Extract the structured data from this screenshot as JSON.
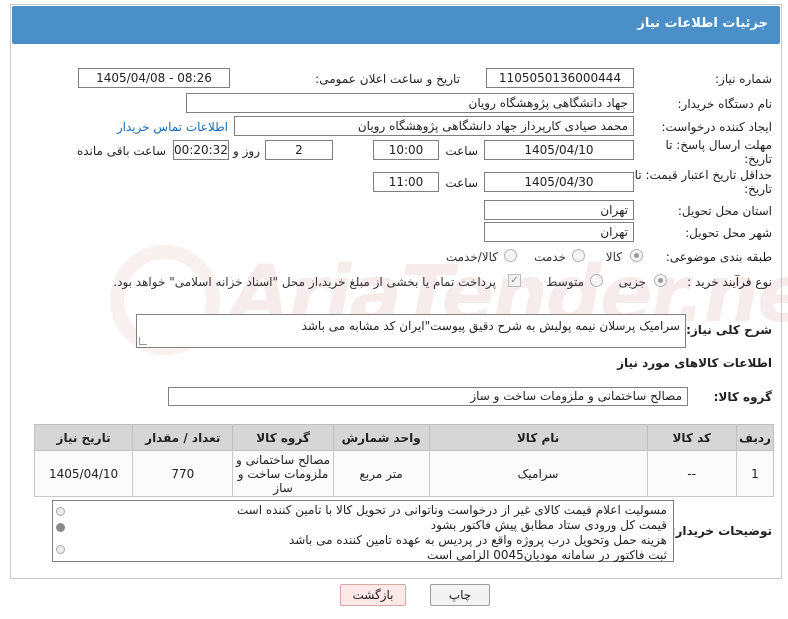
{
  "page": {
    "title": "جزئیات اطلاعات نیاز"
  },
  "form": {
    "need_number_label": "شماره نیاز:",
    "need_number": "1105050136000444",
    "announce_label": "تاریخ و ساعت اعلان عمومی:",
    "announce_value": "1405/04/08 - 08:26",
    "buyer_org_label": "نام دستگاه خریدار:",
    "buyer_org": "جهاد دانشگاهی پژوهشگاه رویان",
    "creator_label": "ایجاد کننده درخواست:",
    "creator": "محمد صیادی کارپرداز جهاد دانشگاهی پژوهشگاه رویان",
    "contact_link": "اطلاعات تماس خریدار",
    "deadline_label": "مهلت ارسال پاسخ: تا تاریخ:",
    "deadline_date": "1405/04/10",
    "time_label": "ساعت",
    "deadline_time": "10:00",
    "days_value": "2",
    "days_label": "روز و",
    "remaining_time": "00:20:32",
    "remaining_label": "ساعت باقی مانده",
    "validity_label": "حداقل تاریخ اعتبار قیمت: تا تاریخ:",
    "validity_date": "1405/04/30",
    "validity_time_label": "ساعت",
    "validity_time": "11:00",
    "province_label": "استان محل تحویل:",
    "province": "تهران",
    "city_label": "شهر محل تحویل:",
    "city": "تهران",
    "category_label": "طبقه بندی موضوعی:",
    "category_options": [
      "کالا",
      "خدمت",
      "کالا/خدمت"
    ],
    "process_label": "نوع فرآیند خرید :",
    "process_options": [
      "جزیی",
      "متوسط"
    ],
    "payment_note": "پرداخت تمام یا بخشی از مبلغ خرید،از محل \"اسناد خزانه اسلامی\" خواهد بود.",
    "summary_label": "شرح کلی نیاز:",
    "summary": "سرامیک پرسلان نیمه پولیش به شرح دقیق پیوست\"ایران کد مشابه می باشد"
  },
  "goods": {
    "section_title": "اطلاعات کالاهای مورد نیاز",
    "group_label": "گروه کالا:",
    "group_value": "مصالح ساختمانی و ملزومات ساخت و ساز",
    "columns": [
      "ردیف",
      "کد کالا",
      "نام کالا",
      "واحد شمارش",
      "گروه کالا",
      "تعداد / مقدار",
      "تاریخ نیاز"
    ],
    "rows": [
      {
        "row": "1",
        "code": "--",
        "name": "سرامیک",
        "unit": "متر مربع",
        "group": "مصالح ساختمانی و ملزومات ساخت و ساز",
        "qty": "770",
        "date": "1405/04/10"
      }
    ]
  },
  "buyer_notes": {
    "label": "توضیحات خریدار:",
    "lines": [
      "مسولیت اعلام  قیمت کالای غیر از درخواست وناتوانی در تحویل کالا با تامین کننده است",
      "قیمت کل ورودی ستاد مطابق پیش فاکتور بشود",
      "هزینه حمل وتحویل درب پروژه واقع در پردیس به عهده تامین کننده می باشد",
      "ثبت فاکتور در سامانه مودیان0045 الزامی است"
    ]
  },
  "buttons": {
    "print": "چاپ",
    "back": "بازگشت"
  },
  "watermark": "AriaTender.net"
}
